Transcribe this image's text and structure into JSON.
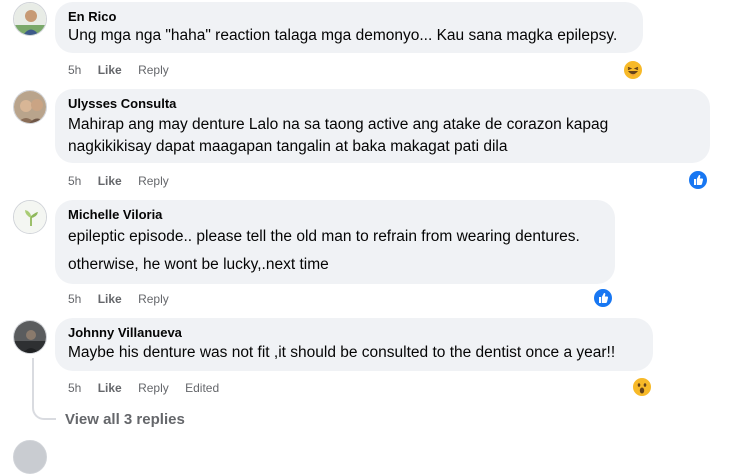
{
  "comments": [
    {
      "author": "En Rico",
      "lines": [
        "Ung mga nga \"haha\" reaction talaga mga demonyo... Kau sana magka epilepsy."
      ],
      "time": "5h",
      "like": "Like",
      "reply": "Reply",
      "reaction": "haha"
    },
    {
      "author": "Ulysses Consulta",
      "lines": [
        "Mahirap ang may denture Lalo na sa taong active ang atake de corazon kapag",
        "nagkikikisay dapat maagapan tangalin at baka makagat pati dila"
      ],
      "time": "5h",
      "like": "Like",
      "reply": "Reply",
      "reaction": "like"
    },
    {
      "author": "Michelle Viloria",
      "lines": [
        "epileptic episode.. please tell the old man to refrain from wearing dentures.",
        "otherwise, he wont be lucky,.next time"
      ],
      "time": "5h",
      "like": "Like",
      "reply": "Reply",
      "reaction": "like"
    },
    {
      "author": "Johnny Villanueva",
      "lines": [
        "Maybe his denture was not fit ,it should be consulted to the dentist once a year!!"
      ],
      "time": "5h",
      "like": "Like",
      "reply": "Reply",
      "edited": "Edited",
      "reaction": "wow"
    }
  ],
  "view_replies": "View all 3 replies",
  "colors": {
    "bubble": "#f0f2f5",
    "meta": "#65676b",
    "like_blue": "#1877f2",
    "emoji_yellow": "#f7b928"
  }
}
